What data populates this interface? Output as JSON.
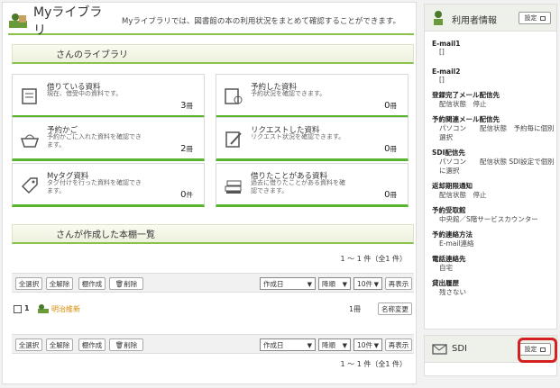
{
  "header": {
    "title": "Myライブラリ",
    "description": "Myライブラリでは、図書館の本の利用状況をまとめて確認することができます。"
  },
  "library_band": "さんのライブラリ",
  "cards": [
    {
      "title": "借りている資料",
      "desc": "現在、借受中の資料です。",
      "count": "3",
      "unit": "冊"
    },
    {
      "title": "予約した資料",
      "desc": "予約状況を確認できます。",
      "count": "0",
      "unit": "冊"
    },
    {
      "title": "予約かご",
      "desc": "予約かごに入れた資料を確認できます。",
      "count": "2",
      "unit": "冊"
    },
    {
      "title": "リクエストした資料",
      "desc": "リクエスト状況を確認できます。",
      "count": "0",
      "unit": "冊"
    },
    {
      "title": "Myタグ資料",
      "desc": "タグ付けを行った資料を確認できます。",
      "count": "0",
      "unit": "件"
    },
    {
      "title": "借りたことがある資料",
      "desc": "過去に借りたことがある資料を確認できます。",
      "count": "0",
      "unit": "冊"
    }
  ],
  "shelf_band": "さんが作成した本棚一覧",
  "count_text": "1 ～ 1 件（全1 件）",
  "toolbar": {
    "select_all": "全選択",
    "deselect_all": "全解除",
    "create_shelf": "棚作成",
    "delete": "削除",
    "sort": "作成日",
    "order": "降順",
    "per_page": "10件",
    "redisplay": "再表示"
  },
  "shelf_row": {
    "number": "1",
    "name": "明治維新",
    "books": "1冊",
    "rename": "名称変更"
  },
  "user_info": {
    "title": "利用者情報",
    "settings": "設定",
    "fields": [
      {
        "label": "E-mail1",
        "value": "[]"
      },
      {
        "label": "E-mail2",
        "value": "[]"
      },
      {
        "label": "登録完了メール配信先",
        "value": "配信状態　停止"
      },
      {
        "label": "予約関連メール配信先",
        "value": "パソコン　　配信状態　予約毎に個別選択"
      },
      {
        "label": "SDI配信先",
        "value": "パソコン　　配信状態 SDI設定で個別に選択"
      },
      {
        "label": "返却期限通知",
        "value": "配信状態　停止"
      },
      {
        "label": "予約受取館",
        "value": "中央館／S階サービスカウンター"
      },
      {
        "label": "予約連絡方法",
        "value": "E-mail連絡"
      },
      {
        "label": "電話連絡先",
        "value": "自宅"
      },
      {
        "label": "貸出履歴",
        "value": "残さない"
      }
    ]
  },
  "sdi": {
    "title": "SDI",
    "settings": "設定"
  },
  "colors": {
    "accent_green": "#8bc34a",
    "card_green": "#5ab52e",
    "highlight_red": "#d42020",
    "shelf_name": "#d68a00"
  }
}
